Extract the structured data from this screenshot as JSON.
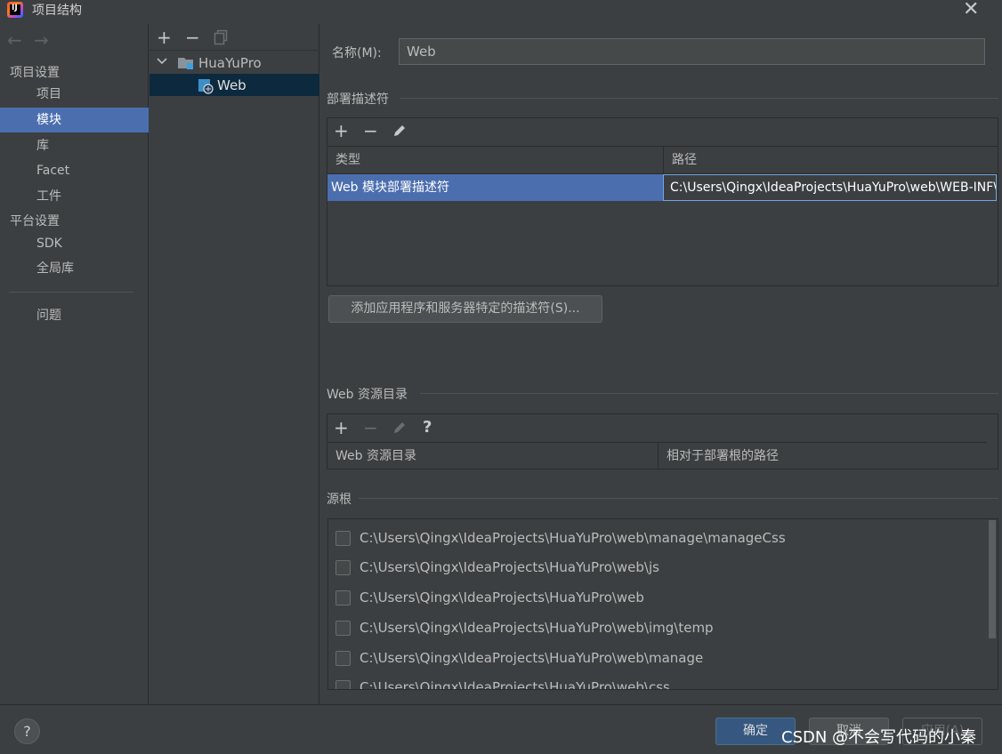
{
  "window": {
    "title": "项目结构",
    "logo_text": "IJ",
    "close_glyph": "✕"
  },
  "nav": {
    "back_glyph": "←",
    "forward_glyph": "→",
    "project_settings_title": "项目设置",
    "project_settings_items": [
      {
        "label": "项目",
        "selected": false
      },
      {
        "label": "模块",
        "selected": true
      },
      {
        "label": "库",
        "selected": false
      },
      {
        "label": "Facet",
        "selected": false
      },
      {
        "label": "工件",
        "selected": false
      }
    ],
    "platform_settings_title": "平台设置",
    "platform_settings_items": [
      {
        "label": "SDK"
      },
      {
        "label": "全局库"
      }
    ],
    "problems_label": "问题"
  },
  "tree": {
    "add_glyph": "+",
    "remove_glyph": "−",
    "copy_icon": "copy-icon",
    "project_name": "HuaYuPro",
    "module_name": "Web",
    "expand_glyph": "⌄"
  },
  "module": {
    "name_label": "名称(M):",
    "name_value": "Web"
  },
  "deployment_descriptors": {
    "title": "部署描述符",
    "toolbar": {
      "add": "+",
      "remove": "−",
      "edit_icon": "pencil-icon"
    },
    "columns": [
      "类型",
      "路径"
    ],
    "rows": [
      {
        "type": "Web 模块部署描述符",
        "path": "C:\\Users\\Qingx\\IdeaProjects\\HuaYuPro\\web\\WEB-INF\\web.xml"
      }
    ],
    "add_server_specific_button": "添加应用程序和服务器特定的描述符(S)..."
  },
  "web_resource_dirs": {
    "title": "Web 资源目录",
    "toolbar": {
      "add": "+",
      "remove": "−",
      "edit_icon": "pencil-icon",
      "help": "?"
    },
    "columns": [
      "Web 资源目录",
      "相对于部署根的路径"
    ]
  },
  "source_roots": {
    "title": "源根",
    "items": [
      {
        "path": "C:\\Users\\Qingx\\IdeaProjects\\HuaYuPro\\web\\manage\\manageCss",
        "checked": false
      },
      {
        "path": "C:\\Users\\Qingx\\IdeaProjects\\HuaYuPro\\web\\js",
        "checked": false
      },
      {
        "path": "C:\\Users\\Qingx\\IdeaProjects\\HuaYuPro\\web",
        "checked": false
      },
      {
        "path": "C:\\Users\\Qingx\\IdeaProjects\\HuaYuPro\\web\\img\\temp",
        "checked": false
      },
      {
        "path": "C:\\Users\\Qingx\\IdeaProjects\\HuaYuPro\\web\\manage",
        "checked": false
      },
      {
        "path": "C:\\Users\\Qingx\\IdeaProjects\\HuaYuPro\\web\\css",
        "checked": false
      }
    ]
  },
  "footer": {
    "help_glyph": "?",
    "ok_label": "确定",
    "cancel_label": "取消",
    "apply_label": "应用(A)",
    "watermark": "CSDN @不会写代码的小秦"
  },
  "colors": {
    "background": "#3c3f41",
    "selection": "#4b6eaf",
    "tree_selection": "#0d293e",
    "text": "#bbbbbb",
    "ok_button": "#365880"
  }
}
